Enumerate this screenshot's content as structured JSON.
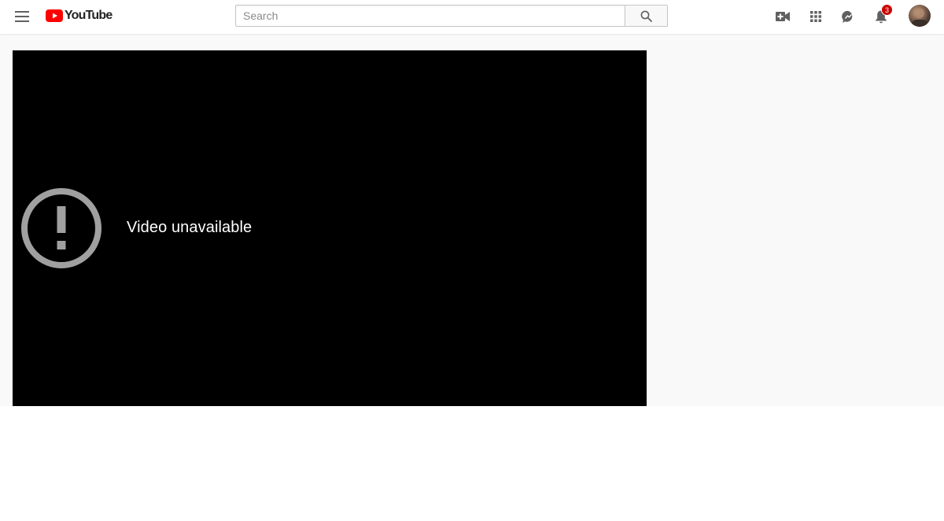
{
  "masthead": {
    "logo_text": "YouTube",
    "search": {
      "placeholder": "Search",
      "value": ""
    },
    "notifications": {
      "count": "3"
    }
  },
  "player": {
    "error_message": "Video unavailable"
  },
  "icons": {
    "menu": "hamburger-menu-icon",
    "logo": "youtube-play-icon",
    "search": "search-icon",
    "create": "video-camera-plus-icon",
    "apps": "apps-grid-icon",
    "messages": "chat-bubble-icon",
    "notifications": "bell-icon",
    "error": "exclamation-circle-icon"
  },
  "colors": {
    "brand_red": "#ff0000",
    "badge_red": "#cc0000",
    "icon_gray": "#606060",
    "player_bg": "#000000",
    "page_bg": "#f9f9f9",
    "error_icon": "#a0a0a0"
  }
}
